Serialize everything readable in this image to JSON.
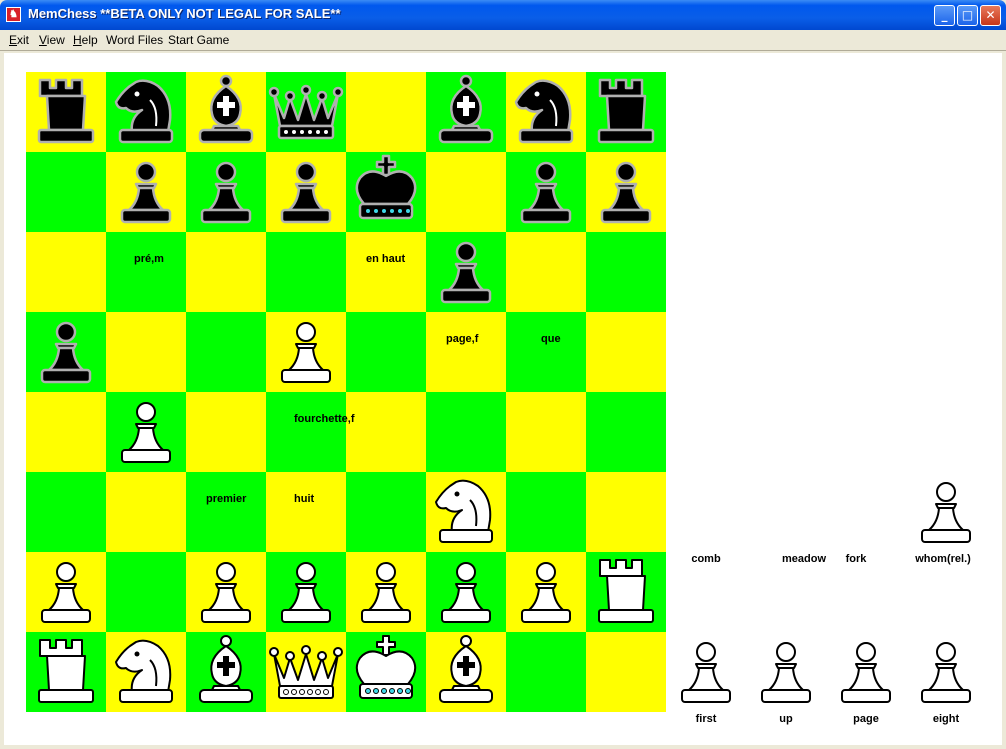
{
  "window": {
    "title": "MemChess **BETA ONLY NOT LEGAL FOR SALE**",
    "minimize": "_",
    "maximize": "□",
    "close": "✕"
  },
  "menu": [
    {
      "mnemonic": "E",
      "rest": "xit"
    },
    {
      "mnemonic": "V",
      "rest": "iew"
    },
    {
      "mnemonic": "H",
      "rest": "elp"
    },
    {
      "mnemonic": "",
      "rest": "Word Files"
    },
    {
      "mnemonic": "",
      "rest": "Start Game"
    }
  ],
  "colors": {
    "light_square": "#ffff00",
    "dark_square": "#00ff00"
  },
  "board": {
    "rows": [
      [
        "br",
        "bn",
        "bb",
        "bq",
        "",
        "bb",
        "bn",
        "br"
      ],
      [
        "",
        "bp",
        "bp",
        "bp",
        "bk",
        "",
        "bp",
        "bp"
      ],
      [
        "",
        "",
        "",
        "",
        "",
        "bp",
        "",
        ""
      ],
      [
        "bp",
        "",
        "",
        "wp",
        "",
        "",
        "",
        ""
      ],
      [
        "",
        "wp",
        "",
        "",
        "",
        "",
        "",
        ""
      ],
      [
        "",
        "",
        "",
        "",
        "",
        "wn",
        "",
        ""
      ],
      [
        "wp",
        "",
        "wp",
        "wp",
        "wp",
        "wp",
        "wp",
        "wr"
      ],
      [
        "wr",
        "wn",
        "wb",
        "wq",
        "wk",
        "wb",
        "",
        ""
      ]
    ],
    "words": [
      {
        "row": 2,
        "col": 1,
        "text": "pré,m"
      },
      {
        "row": 2,
        "col": 4,
        "text": "en haut"
      },
      {
        "row": 3,
        "col": 5,
        "text": "page,f"
      },
      {
        "row": 3,
        "col": 6,
        "text": "que"
      },
      {
        "row": 4,
        "col": 3,
        "text": "fourchette,f"
      },
      {
        "row": 5,
        "col": 2,
        "text": "premier"
      },
      {
        "row": 5,
        "col": 3,
        "text": "huit"
      }
    ]
  },
  "captured": {
    "top_piece": {
      "piece": "wp",
      "label": "whom(rel.)"
    },
    "top_labels": [
      "comb",
      "meadow",
      "fork"
    ],
    "bottom": [
      {
        "piece": "wp",
        "label": "first"
      },
      {
        "piece": "wp",
        "label": "up"
      },
      {
        "piece": "wp",
        "label": "page"
      },
      {
        "piece": "wp",
        "label": "eight"
      }
    ]
  },
  "piece_names": {
    "br": "black-rook-icon",
    "bn": "black-knight-icon",
    "bb": "black-bishop-icon",
    "bq": "black-queen-icon",
    "bk": "black-king-icon",
    "bp": "black-pawn-icon",
    "wr": "white-rook-icon",
    "wn": "white-knight-icon",
    "wb": "white-bishop-icon",
    "wq": "white-queen-icon",
    "wk": "white-king-icon",
    "wp": "white-pawn-icon"
  }
}
